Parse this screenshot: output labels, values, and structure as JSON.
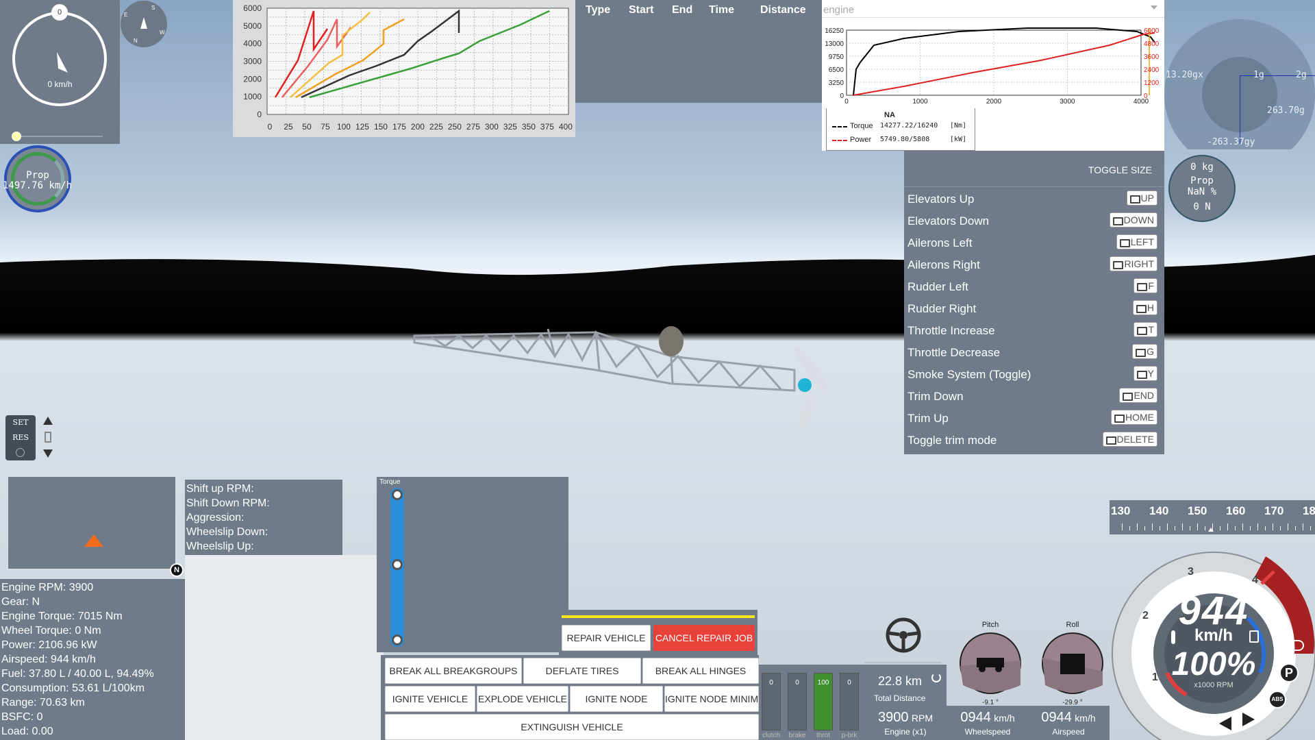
{
  "hud_nav": {
    "heading_value": "0",
    "speed": "0 km/h",
    "compass": [
      "S",
      "E",
      "N",
      "W"
    ]
  },
  "prop_gauge": {
    "label": "Prop",
    "speed": "1497.76 km/h"
  },
  "gear_chart": {
    "y_ticks": [
      "6000",
      "5000",
      "4000",
      "3000",
      "2000",
      "1000",
      "0"
    ],
    "x_ticks": [
      "0",
      "25",
      "50",
      "75",
      "100",
      "125",
      "150",
      "175",
      "200",
      "225",
      "250",
      "275",
      "300",
      "325",
      "350",
      "375",
      "400"
    ]
  },
  "times_table": {
    "headers": [
      "Type",
      "Start",
      "End",
      "Time",
      "Distance"
    ]
  },
  "engine_graph": {
    "dropdown": "engine",
    "y_left": [
      "16250",
      "13000",
      "9750",
      "6500",
      "3250",
      "0"
    ],
    "y_right": [
      "6000",
      "4800",
      "3600",
      "2400",
      "1200",
      "0"
    ],
    "x_ticks": [
      "0",
      "1000",
      "2000",
      "3000",
      "4000"
    ],
    "legend_title": "NA",
    "torque_label": "Torque",
    "torque_value": "14277.22/16240",
    "torque_unit": "[Nm]",
    "power_label": "Power",
    "power_value": "5749.80/5808",
    "power_unit": "[kW]"
  },
  "attitude": {
    "left": "13.20gx",
    "top": "1g",
    "right": "2g",
    "mid": "263.70g",
    "bottom": "-263.37gy"
  },
  "prop_info": {
    "mass": "0 kg",
    "label": "Prop",
    "pct": "NaN %",
    "force": "0 N"
  },
  "keys_panel": {
    "toggle": "TOGGLE SIZE",
    "rows": [
      {
        "label": "Elevators Up",
        "key": "UP"
      },
      {
        "label": "Elevators Down",
        "key": "DOWN"
      },
      {
        "label": "Ailerons Left",
        "key": "LEFT"
      },
      {
        "label": "Ailerons Right",
        "key": "RIGHT"
      },
      {
        "label": "Rudder Left",
        "key": "F"
      },
      {
        "label": "Rudder Right",
        "key": "H"
      },
      {
        "label": "Throttle Increase",
        "key": "T"
      },
      {
        "label": "Throttle Decrease",
        "key": "G"
      },
      {
        "label": "Smoke System (Toggle)",
        "key": "Y"
      },
      {
        "label": "Trim Down",
        "key": "END"
      },
      {
        "label": "Trim Up",
        "key": "HOME"
      },
      {
        "label": "Toggle trim mode",
        "key": "DELETE"
      }
    ]
  },
  "cruise": {
    "set": "SET",
    "res": "RES"
  },
  "minimap": {
    "north": "N"
  },
  "shift_info": [
    "Shift up RPM:",
    "Shift Down RPM:",
    "Aggression:",
    "Wheelslip Down:",
    "Wheelslip Up:"
  ],
  "vehicle_info": [
    "Engine RPM: 3900",
    "Gear: N",
    "Engine Torque: 7015 Nm",
    "Wheel Torque: 0 Nm",
    "Power: 2106.96 kW",
    "Airspeed: 944 km/h",
    "Fuel: 37.80 L / 40.00 L, 94.49%",
    "Consumption: 53.61 L/100km",
    "Range: 70.63 km",
    "BSFC: 0",
    "Load: 0.00"
  ],
  "torque_panel": {
    "title": "Torque"
  },
  "repair": {
    "repair": "REPAIR VEHICLE",
    "cancel": "CANCEL REPAIR JOB"
  },
  "actions": {
    "break_groups": "BREAK ALL BREAKGROUPS",
    "deflate": "DEFLATE TIRES",
    "break_hinges": "BREAK ALL HINGES",
    "ignite": "IGNITE VEHICLE",
    "explode": "EXPLODE VEHICLE",
    "ignite_node": "IGNITE NODE",
    "ignite_node_min": "IGNITE NODE MINIM",
    "extinguish": "EXTINGUISH VEHICLE"
  },
  "pedals": [
    {
      "label": "clutch",
      "value": "0",
      "level": 0
    },
    {
      "label": "brake",
      "value": "0",
      "level": 0
    },
    {
      "label": "throt",
      "value": "100",
      "level": 1
    },
    {
      "label": "p-brk",
      "value": "0",
      "level": 0
    }
  ],
  "trip": {
    "distance": "22.8 km",
    "label": "Total Distance"
  },
  "readouts": {
    "rpm": "3900",
    "rpm_unit": "RPM",
    "rpm_label": "Engine (x1)",
    "wheel": "0944",
    "wheel_unit": "km/h",
    "wheel_label": "Wheelspeed",
    "air": "0944",
    "air_unit": "km/h",
    "air_label": "Airspeed"
  },
  "pitch": {
    "label": "Pitch",
    "value": "-9.1 °"
  },
  "roll": {
    "label": "Roll",
    "value": "-29.9 °"
  },
  "tape": {
    "ticks": [
      "130",
      "140",
      "150",
      "160",
      "170",
      "18"
    ]
  },
  "speedo": {
    "speed": "944",
    "unit": "km/h",
    "throttle": "100%",
    "rpm_label": "x1000 RPM",
    "marks": [
      "1",
      "2",
      "3",
      "4"
    ],
    "park": "P",
    "abs": "ABS"
  },
  "colors": {
    "panel": "#6f7b88",
    "accent_red": "#e8413a",
    "gauge_blue": "#2a4fb5",
    "green": "#3e8f2e"
  }
}
